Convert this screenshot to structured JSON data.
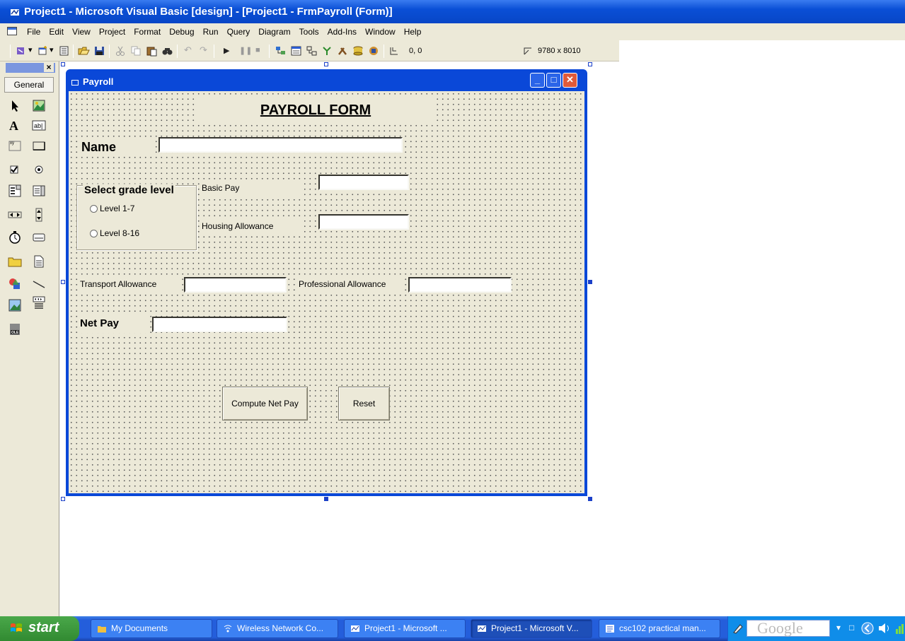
{
  "window": {
    "title": "Project1 - Microsoft Visual Basic [design] - [Project1 - FrmPayroll (Form)]"
  },
  "menu": {
    "items": [
      "File",
      "Edit",
      "View",
      "Project",
      "Format",
      "Debug",
      "Run",
      "Query",
      "Diagram",
      "Tools",
      "Add-Ins",
      "Window",
      "Help"
    ]
  },
  "toolbar": {
    "position_text": "0, 0",
    "size_text": "9780 x 8010"
  },
  "toolbox": {
    "close_label": "×",
    "tab_label": "General",
    "tools": [
      "pointer-icon",
      "picturebox-icon",
      "label-icon",
      "textbox-icon",
      "frame-icon",
      "commandbutton-icon",
      "checkbox-icon",
      "optionbutton-icon",
      "combobox-icon",
      "listbox-icon",
      "hscrollbar-icon",
      "vscrollbar-icon",
      "timer-icon",
      "drivelistbox-icon",
      "dirlistbox-icon",
      "filelistbox-icon",
      "shape-icon",
      "line-icon",
      "image-icon",
      "data-icon",
      "ole-icon"
    ]
  },
  "form": {
    "caption": "Payroll",
    "heading": "PAYROLL FORM",
    "name_label": "Name",
    "name_value": "",
    "grade_frame_caption": "Select grade level",
    "grade_options": [
      "Level 1-7",
      "Level 8-16"
    ],
    "basic_pay_label": "Basic Pay",
    "basic_pay_value": "",
    "housing_label": "Housing Allowance",
    "housing_value": "",
    "transport_label": "Transport Allowance",
    "transport_value": "",
    "professional_label": "Professional  Allowance",
    "professional_value": "",
    "net_pay_label": "Net Pay",
    "net_pay_value": "",
    "compute_button": "Compute Net Pay",
    "reset_button": "Reset"
  },
  "taskbar": {
    "start_label": "start",
    "tasks": [
      "My Documents",
      "Wireless Network Co...",
      "Project1 - Microsoft ...",
      "Project1 - Microsoft V...",
      "csc102 practical man..."
    ],
    "active_task_index": 3,
    "search_brand": "Google"
  },
  "colors": {
    "title_bar": "#0a4fd6",
    "form_face": "#ece9d8",
    "selection_handle": "#1b40c8",
    "taskbar": "#245edb",
    "start_button": "#318a31"
  }
}
